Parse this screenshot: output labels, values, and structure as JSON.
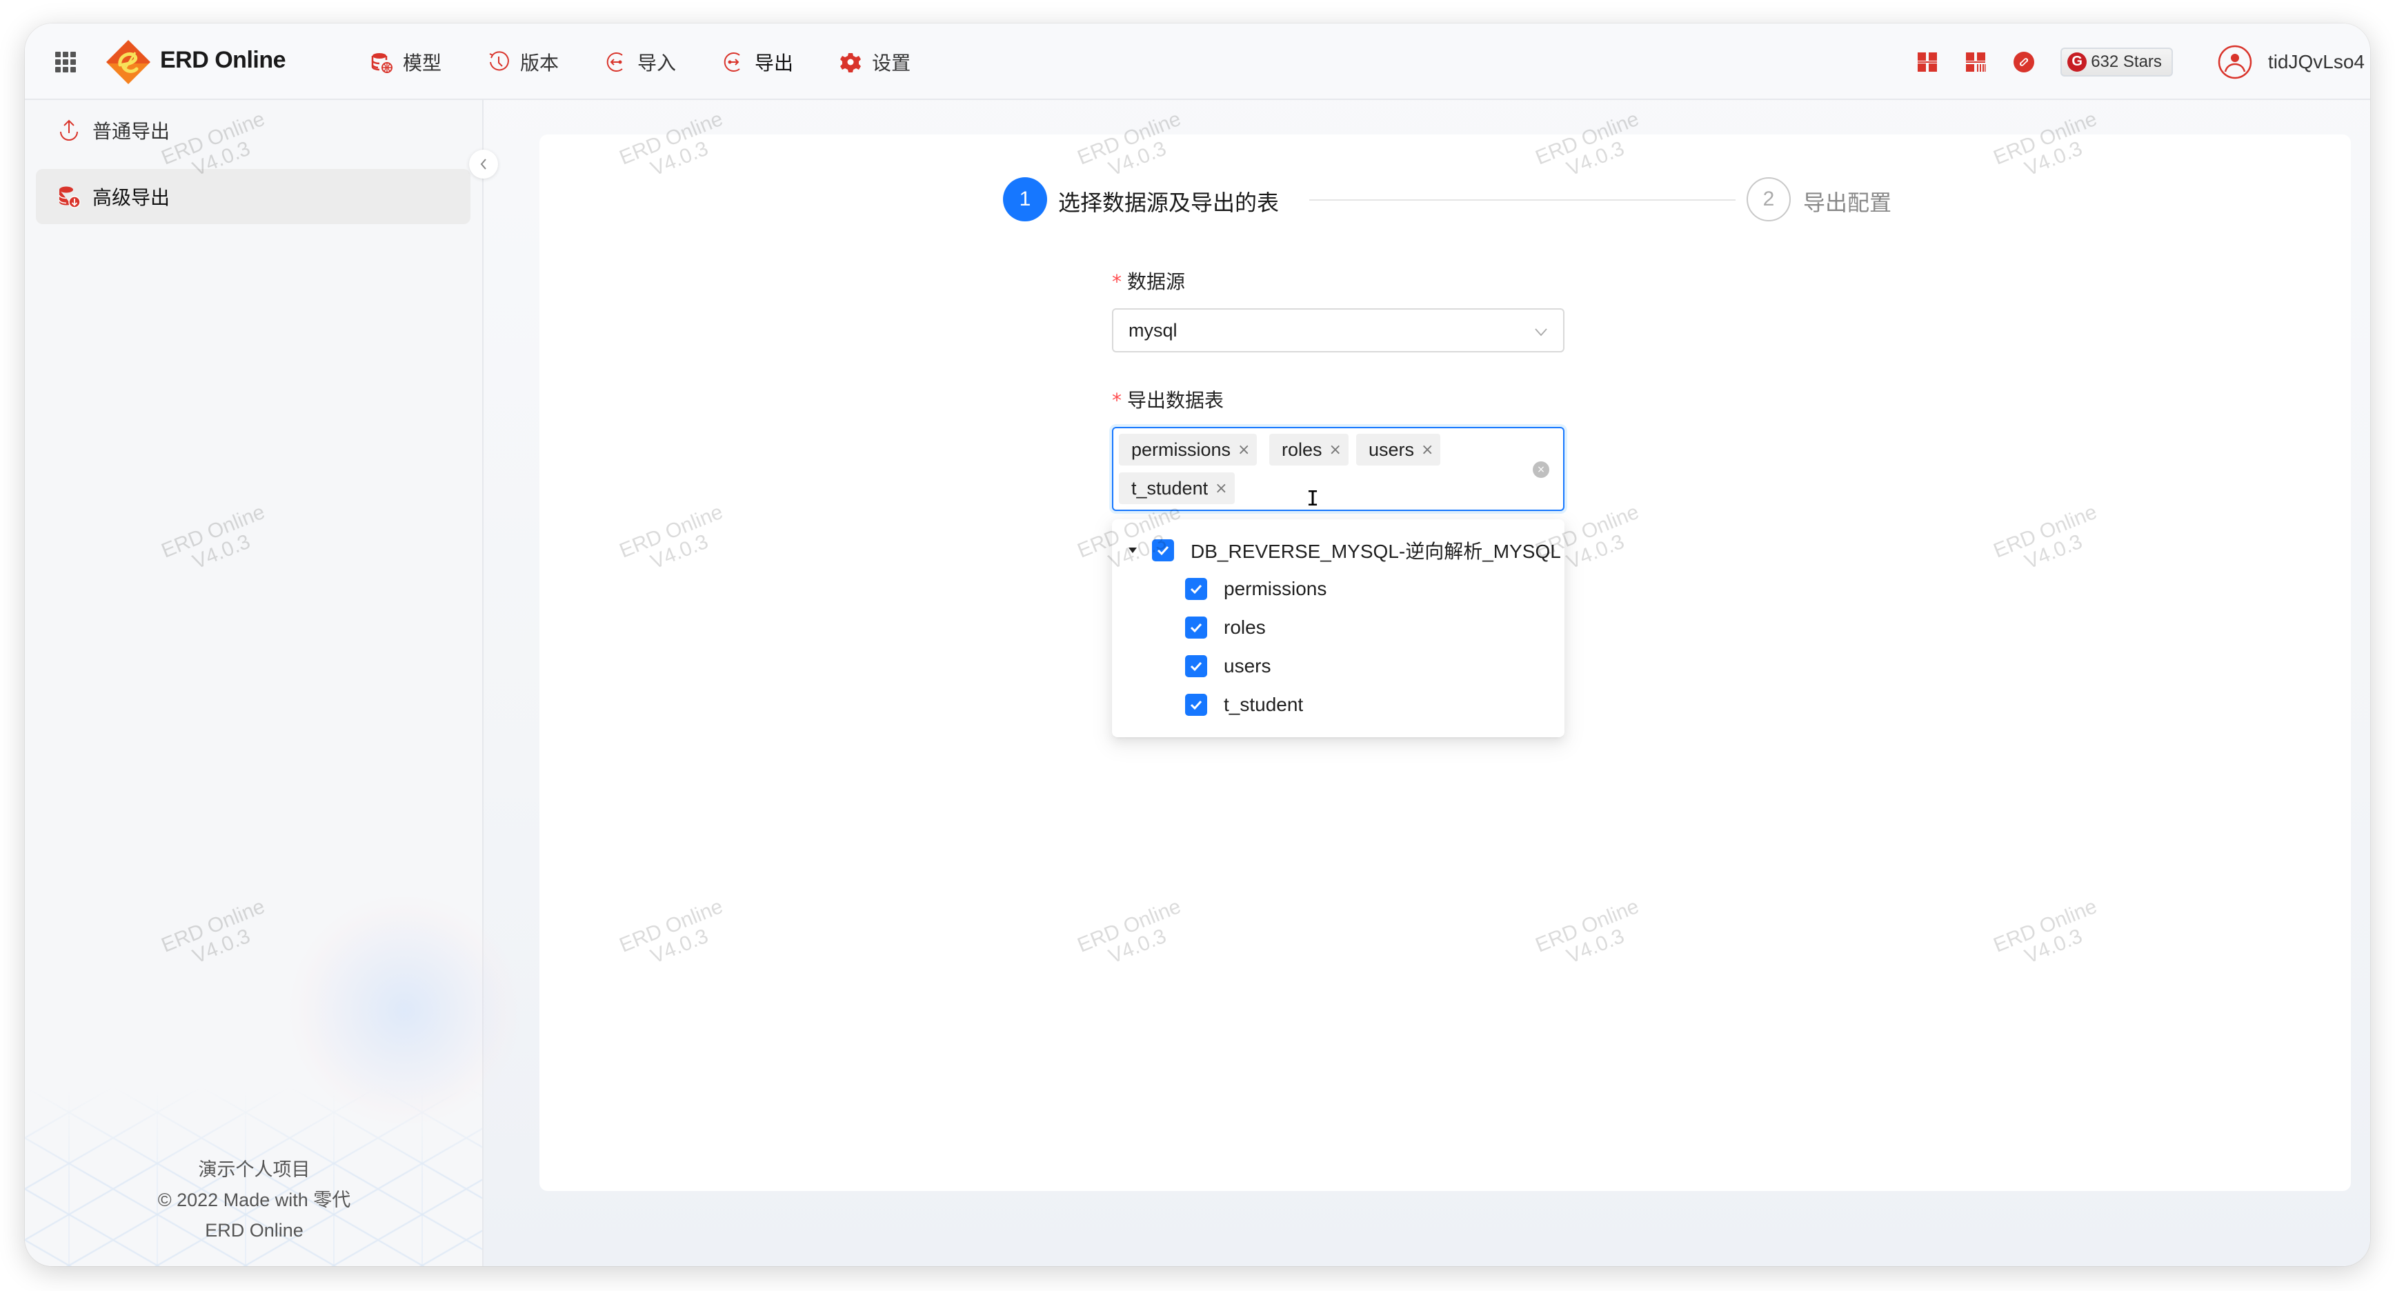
{
  "header": {
    "app_name": "ERD Online",
    "nav": [
      {
        "label": "模型",
        "icon": "database-globe-icon"
      },
      {
        "label": "版本",
        "icon": "history-icon"
      },
      {
        "label": "导入",
        "icon": "import-icon"
      },
      {
        "label": "导出",
        "icon": "export-icon",
        "active": true
      },
      {
        "label": "设置",
        "icon": "gear-icon"
      }
    ],
    "right_icons": [
      "qrcode-icon-1",
      "qrcode-icon-2",
      "link-icon"
    ],
    "stars_label": "632 Stars",
    "stars_badge": "G",
    "username": "tidJQvLso4"
  },
  "sidebar": {
    "items": [
      {
        "label": "普通导出",
        "icon": "upload-icon",
        "active": false
      },
      {
        "label": "高级导出",
        "icon": "database-export-icon",
        "active": true
      }
    ],
    "footer": {
      "line1": "演示个人项目",
      "line2": "© 2022 Made with 零代",
      "line3": "ERD Online"
    }
  },
  "steps": [
    {
      "number": "1",
      "title": "选择数据源及导出的表",
      "status": "active"
    },
    {
      "number": "2",
      "title": "导出配置",
      "status": "wait"
    }
  ],
  "form": {
    "datasource": {
      "required_mark": "*",
      "label": "数据源",
      "value": "mysql"
    },
    "tables": {
      "required_mark": "*",
      "label": "导出数据表",
      "selected_tags": [
        "permissions",
        "roles",
        "users",
        "t_student"
      ],
      "tag_close": "×",
      "clear": "×"
    },
    "tree": {
      "root": {
        "label": "DB_REVERSE_MYSQL-逆向解析_MYSQL",
        "checked": true,
        "expanded": true
      },
      "children": [
        {
          "label": "permissions",
          "checked": true
        },
        {
          "label": "roles",
          "checked": true
        },
        {
          "label": "users",
          "checked": true
        },
        {
          "label": "t_student",
          "checked": true
        }
      ]
    }
  },
  "watermark": {
    "line1": "ERD Online",
    "line2": "V4.0.3"
  },
  "colors": {
    "primary": "#1677ff",
    "brand_red": "#d9342b",
    "required": "#ff4d4f"
  }
}
